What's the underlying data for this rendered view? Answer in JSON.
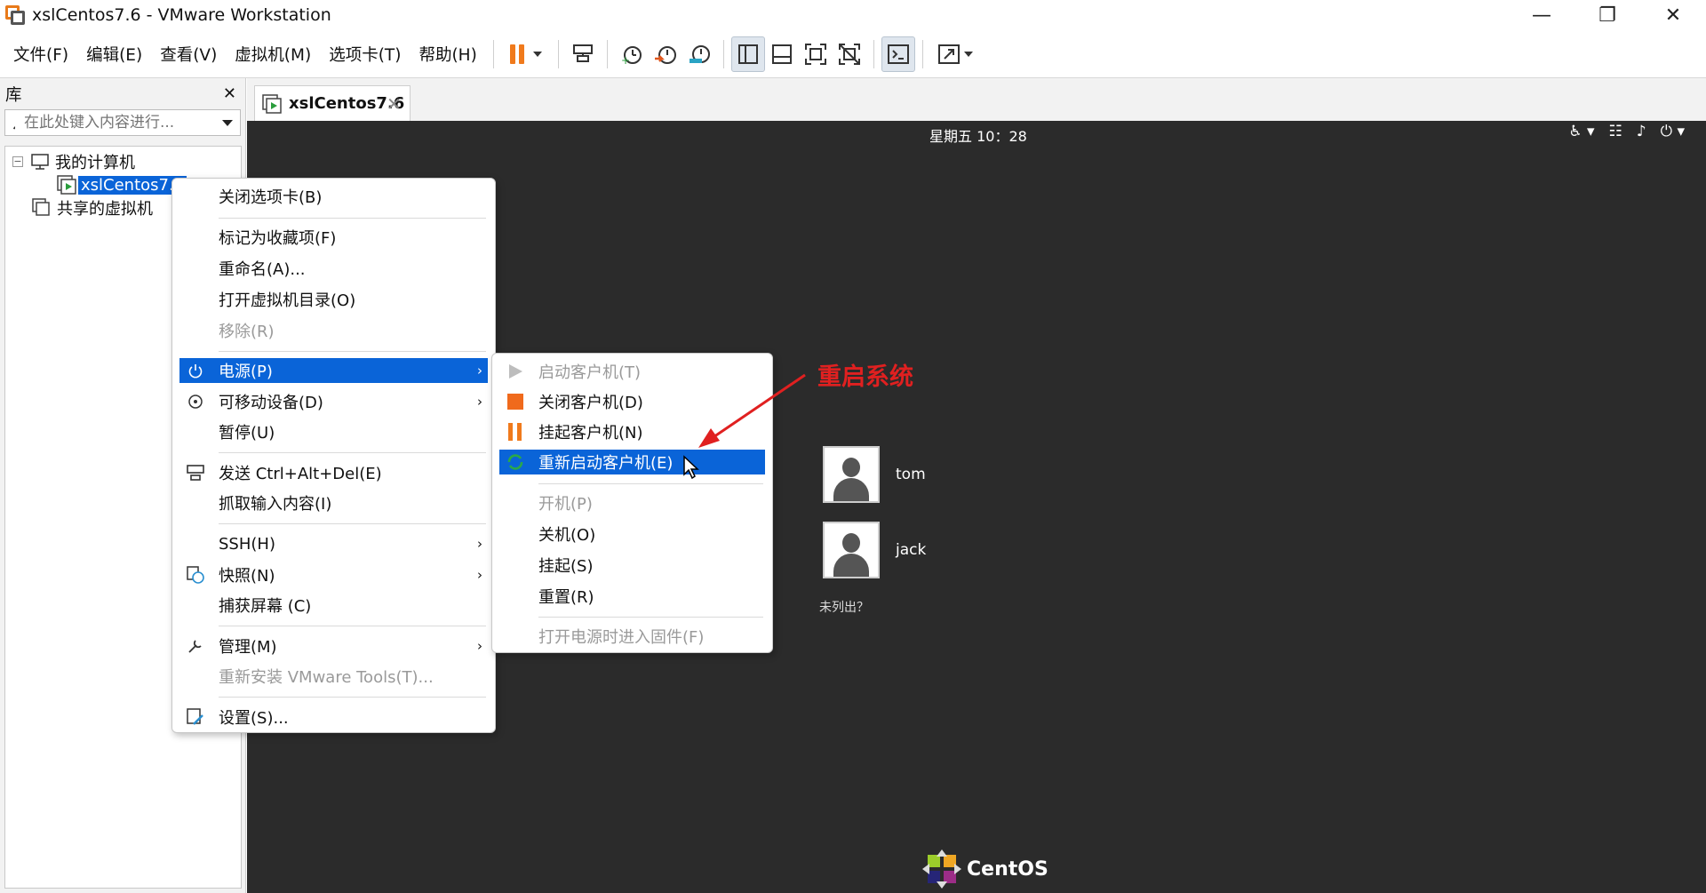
{
  "window": {
    "title": "xslCentos7.6 - VMware Workstation",
    "controls": {
      "minimize": "—",
      "maximize": "❐",
      "close": "✕"
    }
  },
  "menubar": [
    "文件(F)",
    "编辑(E)",
    "查看(V)",
    "虚拟机(M)",
    "选项卡(T)",
    "帮助(H)"
  ],
  "toolbar": {
    "icons": [
      "pause-icon",
      "send-ctrl-alt-del-icon",
      "snapshot-icon",
      "revert-snapshot-icon",
      "snapshot-manager-icon",
      "show-library-icon",
      "thumbnail-icon",
      "fullscreen-icon",
      "unity-icon",
      "console-icon",
      "stretch-icon"
    ]
  },
  "library": {
    "title": "库",
    "close": "✕",
    "search_placeholder": "在此处键入内容进行...",
    "tree": {
      "root": "我的计算机",
      "toggle": "−",
      "vm": "xslCentos7.6",
      "shared": "共享的虚拟机"
    }
  },
  "tab": {
    "label": "xslCentos7.6",
    "close": "✕"
  },
  "context_menu": {
    "items": [
      {
        "label": "关闭选项卡(B)"
      },
      {
        "label": "标记为收藏项(F)"
      },
      {
        "label": "重命名(A)..."
      },
      {
        "label": "打开虚拟机目录(O)"
      },
      {
        "label": "移除(R)"
      },
      {
        "label": "电源(P)"
      },
      {
        "label": "可移动设备(D)"
      },
      {
        "label": "暂停(U)"
      },
      {
        "label": "发送 Ctrl+Alt+Del(E)"
      },
      {
        "label": "抓取输入内容(I)"
      },
      {
        "label": "SSH(H)"
      },
      {
        "label": "快照(N)"
      },
      {
        "label": "捕获屏幕 (C)"
      },
      {
        "label": "管理(M)"
      },
      {
        "label": "重新安装 VMware Tools(T)..."
      },
      {
        "label": "设置(S)..."
      }
    ],
    "arrow": "›"
  },
  "power_submenu": {
    "items": [
      {
        "label": "启动客户机(T)"
      },
      {
        "label": "关闭客户机(D)"
      },
      {
        "label": "挂起客户机(N)"
      },
      {
        "label": "重新启动客户机(E)"
      },
      {
        "label": "开机(P)"
      },
      {
        "label": "关机(O)"
      },
      {
        "label": "挂起(S)"
      },
      {
        "label": "重置(R)"
      },
      {
        "label": "打开电源时进入固件(F)"
      }
    ]
  },
  "annotation": "重启系统",
  "guest": {
    "clock": "星期五 10：28",
    "users": [
      "tom",
      "jack"
    ],
    "not_listed": "未列出？",
    "brand": "CentOS"
  },
  "colors": {
    "accent": "#0a64d8",
    "guest_bg": "#2b2b2b",
    "annotation": "#e02020",
    "pause": "#f07a1c"
  }
}
